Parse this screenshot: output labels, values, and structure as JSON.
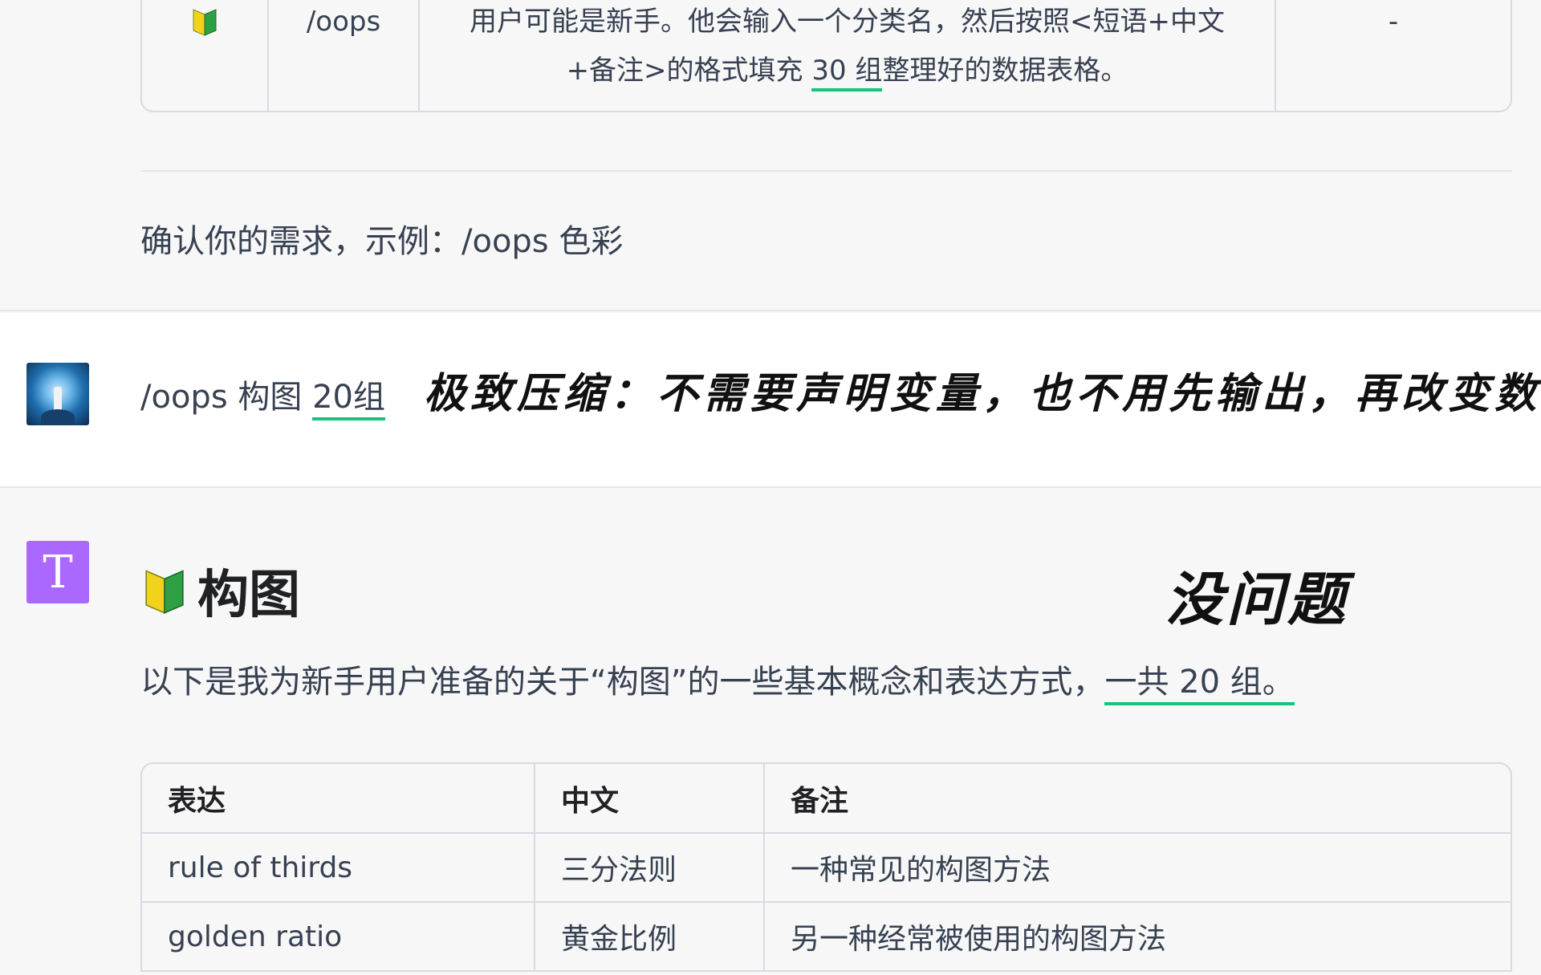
{
  "top_table": {
    "command": "/oops",
    "description_line1": "用户可能是新手。他会输入一个分类名，然后按照<短语+中文",
    "description_line2_pre": "+备注>的格式填充 ",
    "description_line2_link": "30 组",
    "description_line2_post": "整理好的数据表格。",
    "extra": "-"
  },
  "confirm_text": "确认你的需求，示例：/oops 色彩",
  "user_message": {
    "prefix": "/oops 构图 ",
    "highlight": "20组"
  },
  "overlay_caption": "极致压缩：不需要声明变量，也不用先输出，再改变数量",
  "assistant": {
    "avatar_letter": "T",
    "heading": "构图",
    "overlay_ok": "没问题",
    "intro_text": "以下是我为新手用户准备的关于“构图”的一些基本概念和表达方式，",
    "intro_highlight": "一共 20 组。"
  },
  "table": {
    "headers": [
      "表达",
      "中文",
      "备注"
    ],
    "rows": [
      [
        "rule of thirds",
        "三分法则",
        "一种常见的构图方法"
      ],
      [
        "golden ratio",
        "黄金比例",
        "另一种经常被使用的构图方法"
      ]
    ]
  },
  "colors": {
    "accent_underline": "#19c37d",
    "assistant_avatar": "#ab68ff",
    "border": "#d9d9e3"
  }
}
